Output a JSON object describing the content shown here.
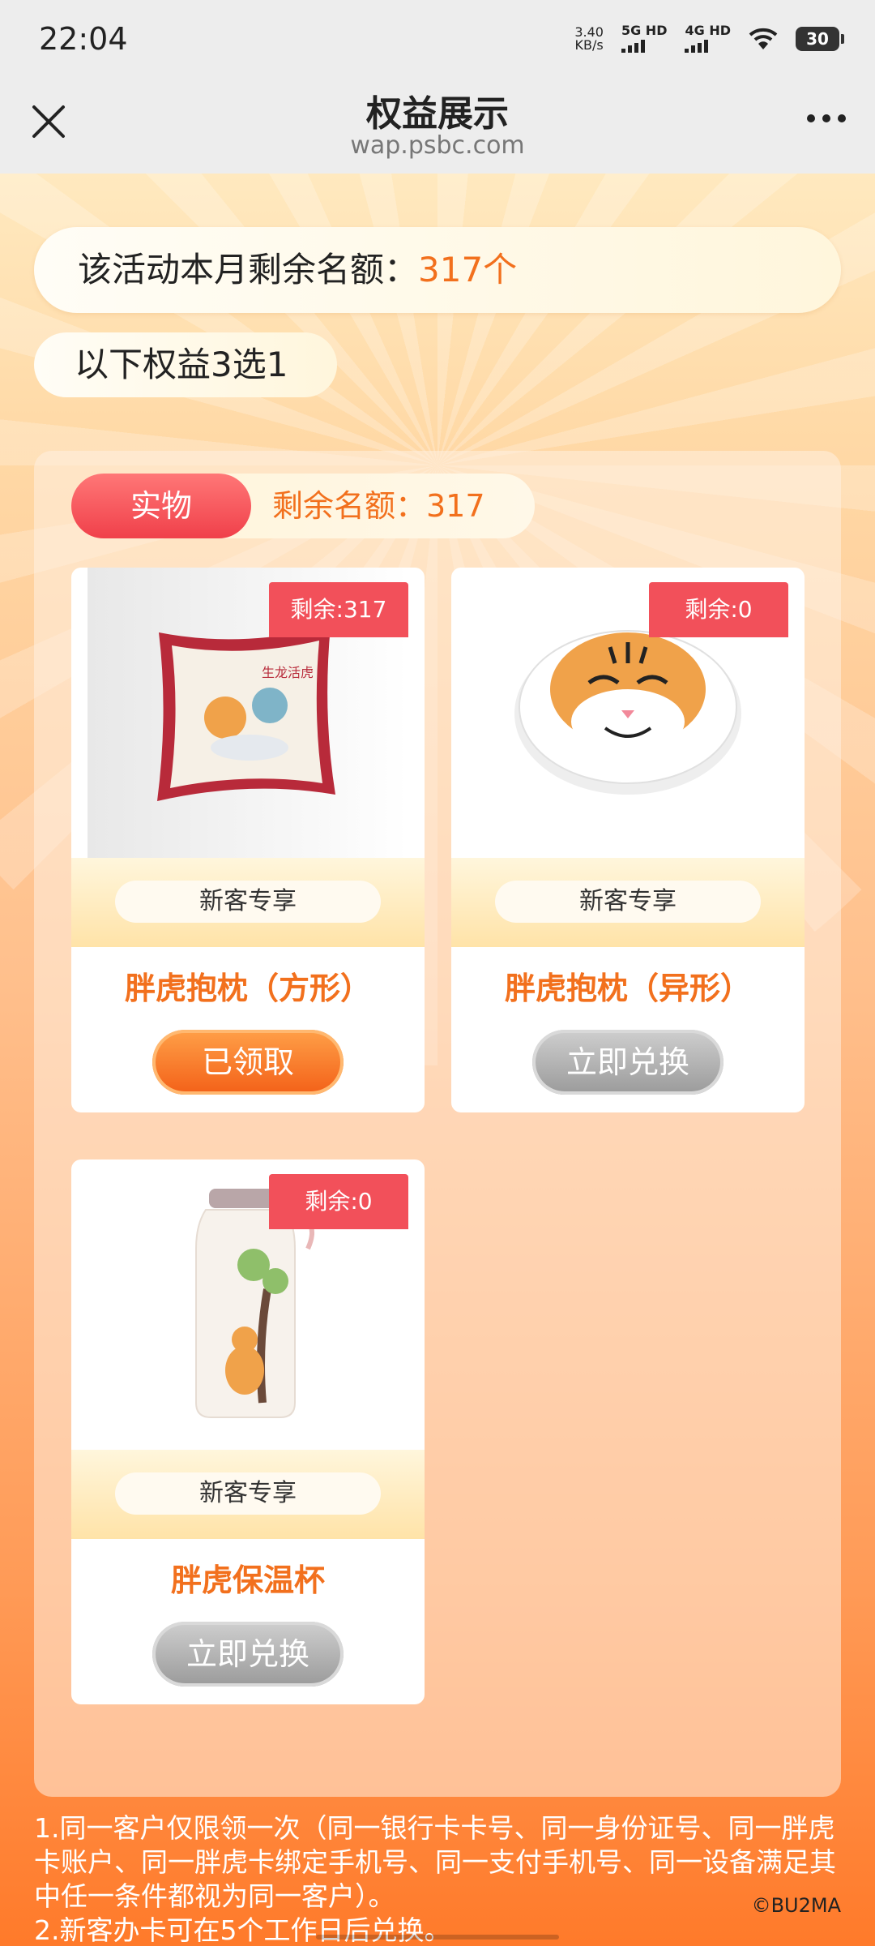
{
  "status_bar": {
    "time": "22:04",
    "net_speed_value": "3.40",
    "net_speed_unit": "KB/s",
    "sim1": "5G HD",
    "sim2": "4G HD",
    "battery": "30"
  },
  "nav": {
    "title": "权益展示",
    "url": "wap.psbc.com"
  },
  "quota": {
    "label": "该活动本月剩余名额：",
    "value": "317个"
  },
  "choose_text": "以下权益3选1",
  "tab": {
    "active_label": "实物",
    "remaining": "剩余名额：317"
  },
  "products": [
    {
      "badge": "剩余:317",
      "tag": "新客专享",
      "name": "胖虎抱枕（方形）",
      "button": "已领取"
    },
    {
      "badge": "剩余:0",
      "tag": "新客专享",
      "name": "胖虎抱枕（异形）",
      "button": "立即兑换"
    },
    {
      "badge": "剩余:0",
      "tag": "新客专享",
      "name": "胖虎保温杯",
      "button": "立即兑换"
    }
  ],
  "rules": {
    "line1": "1.同一客户仅限领一次（同一银行卡卡号、同一身份证号、同一胖虎卡账户、同一胖虎卡绑定手机号、同一支付手机号、同一设备满足其中任一条件都视为同一客户）。",
    "line2": "2.新客办卡可在5个工作日后兑换。"
  },
  "copyright": "©BU2MA",
  "colors": {
    "accent": "#f2701d",
    "badge": "#f2505a",
    "tab_active": "#f0404a"
  }
}
